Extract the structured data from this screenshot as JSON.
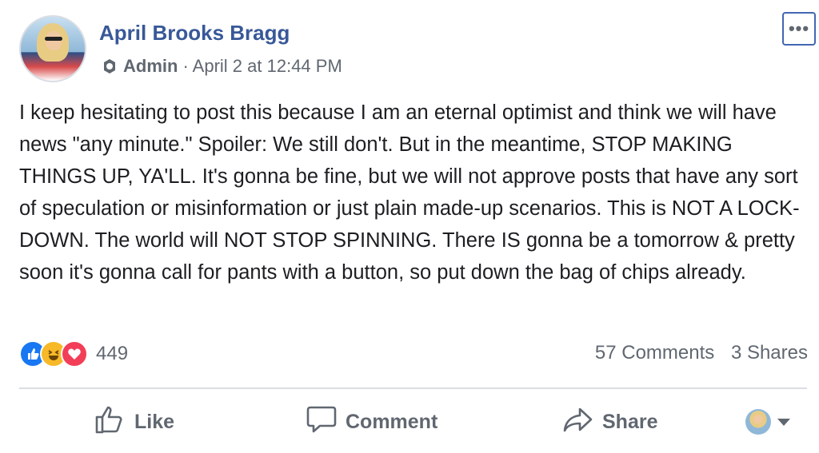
{
  "post": {
    "author": "April Brooks Bragg",
    "role": "Admin",
    "timestamp": "· April 2 at 12:44 PM",
    "menu_label": "•••",
    "text": "I keep hesitating to post this because I am an eternal optimist and think we will have news \"any minute.\" Spoiler: We still don't. But in the meantime, STOP MAKING THINGS UP, YA'LL. It's gonna be fine, but we will not approve posts that have any sort of speculation or misinformation or just plain made-up scenarios. This is NOT A LOCK-DOWN. The world will NOT STOP SPINNING. There IS gonna be a tomorrow & pretty soon it's gonna call for pants with a button, so put down the bag of chips already."
  },
  "engagement": {
    "reaction_count": "449",
    "reactions": [
      "like-reaction-icon",
      "haha-reaction-icon",
      "love-reaction-icon"
    ],
    "comments": "57 Comments",
    "shares": "3 Shares"
  },
  "actions": {
    "like": "Like",
    "comment": "Comment",
    "share": "Share"
  },
  "colors": {
    "author_blue": "#385898",
    "muted_gray": "#606770",
    "like_blue": "#1877f2",
    "haha_yellow": "#f7b928",
    "love_red": "#f33e58"
  }
}
